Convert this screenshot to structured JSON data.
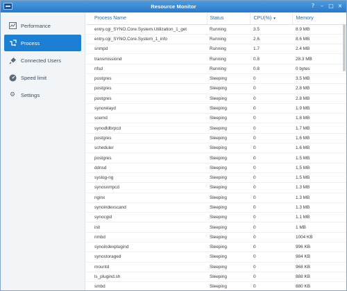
{
  "window": {
    "title": "Resource Monitor"
  },
  "sidebar": {
    "items": [
      {
        "label": "Performance",
        "icon": "performance-chart-icon",
        "active": false
      },
      {
        "label": "Process",
        "icon": "process-icon",
        "active": true
      },
      {
        "label": "Connected Users",
        "icon": "plug-icon",
        "active": false
      },
      {
        "label": "Speed limit",
        "icon": "speedometer-icon",
        "active": false
      },
      {
        "label": "Settings",
        "icon": "gear-icon",
        "active": false
      }
    ]
  },
  "table": {
    "columns": [
      "Process Name",
      "Status",
      "CPU(%)",
      "Memory"
    ],
    "sort_column": "CPU(%)",
    "sort_direction": "descending",
    "rows": [
      [
        "entry.cgi_SYNO.Core.System.Utilization_1_get",
        "Running",
        "3.5",
        "8.9 MB"
      ],
      [
        "entry.cgi_SYNO.Core.System_1_info",
        "Running",
        "2.6",
        "8.6 MB"
      ],
      [
        "snmpd",
        "Running",
        "1.7",
        "2.4 MB"
      ],
      [
        "transmissiond",
        "Running",
        "0.8",
        "28.3 MB"
      ],
      [
        "nfsd",
        "Running",
        "0.8",
        "0 bytes"
      ],
      [
        "postgres",
        "Sleeping",
        "0",
        "3.5 MB"
      ],
      [
        "postgres",
        "Sleeping",
        "0",
        "2.8 MB"
      ],
      [
        "postgres",
        "Sleeping",
        "0",
        "2.8 MB"
      ],
      [
        "synorelayd",
        "Sleeping",
        "0",
        "1.9 MB"
      ],
      [
        "scemd",
        "Sleeping",
        "0",
        "1.8 MB"
      ],
      [
        "synodldbrpcd",
        "Sleeping",
        "0",
        "1.7 MB"
      ],
      [
        "postgres",
        "Sleeping",
        "0",
        "1.6 MB"
      ],
      [
        "scheduler",
        "Sleeping",
        "0",
        "1.6 MB"
      ],
      [
        "postgres",
        "Sleeping",
        "0",
        "1.5 MB"
      ],
      [
        "ddnsd",
        "Sleeping",
        "0",
        "1.5 MB"
      ],
      [
        "syslog-ng",
        "Sleeping",
        "0",
        "1.5 MB"
      ],
      [
        "synosnmpcd",
        "Sleeping",
        "0",
        "1.3 MB"
      ],
      [
        "nginx",
        "Sleeping",
        "0",
        "1.3 MB"
      ],
      [
        "synoindexscand",
        "Sleeping",
        "0",
        "1.3 MB"
      ],
      [
        "synocgid",
        "Sleeping",
        "0",
        "1.1 MB"
      ],
      [
        "init",
        "Sleeping",
        "0",
        "1 MB"
      ],
      [
        "nmbd",
        "Sleeping",
        "0",
        "1004 KB"
      ],
      [
        "synoindexplugind",
        "Sleeping",
        "0",
        "996 KB"
      ],
      [
        "synostoraged",
        "Sleeping",
        "0",
        "984 KB"
      ],
      [
        "mountd",
        "Sleeping",
        "0",
        "968 KB"
      ],
      [
        "ls_plugind.sh",
        "Sleeping",
        "0",
        "888 KB"
      ],
      [
        "smbd",
        "Sleeping",
        "0",
        "880 KB"
      ]
    ]
  }
}
